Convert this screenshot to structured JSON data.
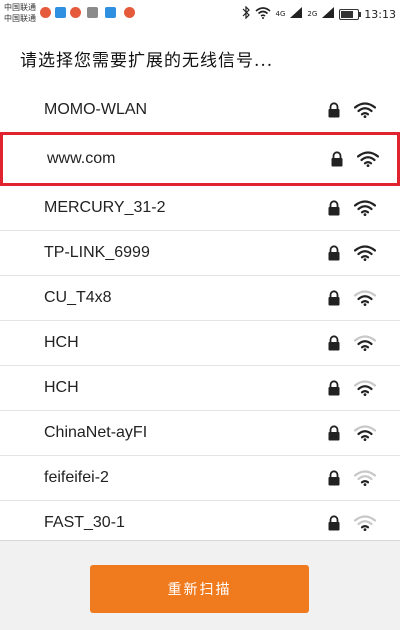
{
  "status_bar": {
    "carrier_1": "中国联通",
    "carrier_2": "中国联通",
    "net_4g": "4G",
    "net_2g": "2G",
    "time": "13:13",
    "notification_icons": [
      "weibo-icon",
      "weibo-icon",
      "app-icon",
      "gallery-icon",
      "video-icon",
      "weibo-icon"
    ],
    "system_icons": [
      "bluetooth-icon",
      "wifi-icon",
      "signal-icon",
      "signal-icon",
      "battery-icon"
    ]
  },
  "header": {
    "title": "请选择您需要扩展的无线信号..."
  },
  "networks": [
    {
      "ssid": "MOMO-WLAN",
      "locked": true,
      "signal": 4
    },
    {
      "ssid": "www.com",
      "locked": true,
      "signal": 4,
      "selected": true
    },
    {
      "ssid": "MERCURY_31-2",
      "locked": true,
      "signal": 4
    },
    {
      "ssid": "TP-LINK_6999",
      "locked": true,
      "signal": 4
    },
    {
      "ssid": "CU_T4x8",
      "locked": true,
      "signal": 3
    },
    {
      "ssid": "HCH",
      "locked": true,
      "signal": 3
    },
    {
      "ssid": "HCH",
      "locked": true,
      "signal": 3
    },
    {
      "ssid": "ChinaNet-ayFI",
      "locked": true,
      "signal": 3
    },
    {
      "ssid": "feifeifei-2",
      "locked": true,
      "signal": 2
    },
    {
      "ssid": "FAST_30-1",
      "locked": true,
      "signal": 2
    }
  ],
  "actions": {
    "rescan_label": "重新扫描"
  },
  "colors": {
    "accent": "#f07a1e",
    "selection_border": "#e0232d"
  }
}
